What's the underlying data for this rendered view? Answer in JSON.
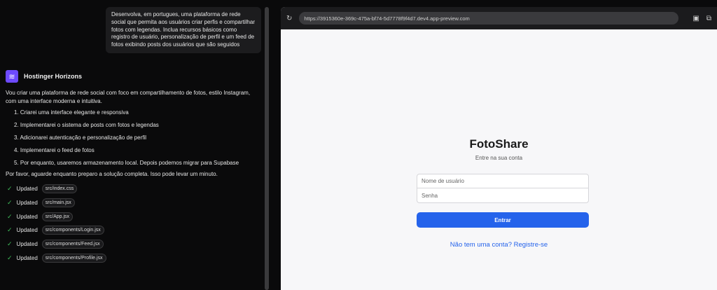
{
  "chat": {
    "user_prompt": "Desenvolva, em portugues, uma plataforma de rede social que permita aos usuários criar perfis e compartilhar fotos com legendas. Inclua recursos básicos como registro de usuário, personalização de perfil e um feed de fotos exibindo posts dos usuários que são seguidos",
    "agent_name": "Hostinger Horizons",
    "intro": "Vou criar uma plataforma de rede social com foco em compartilhamento de fotos, estilo Instagram, com uma interface moderna e intuitiva.",
    "steps": [
      "1. Criarei uma interface elegante e responsiva",
      "2. Implementarei o sistema de posts com fotos e legendas",
      "3. Adicionarei autenticação e personalização de perfil",
      "4. Implementarei o feed de fotos",
      "5. Por enquanto, usaremos armazenamento local. Depois podemos migrar para Supabase"
    ],
    "wait": "Por favor, aguarde enquanto preparo a solução completa. Isso pode levar um minuto.",
    "updates": [
      {
        "label": "Updated",
        "file": "src/index.css"
      },
      {
        "label": "Updated",
        "file": "src/main.jsx"
      },
      {
        "label": "Updated",
        "file": "src/App.jsx"
      },
      {
        "label": "Updated",
        "file": "src/components/Login.jsx"
      },
      {
        "label": "Updated",
        "file": "src/components/Feed.jsx"
      },
      {
        "label": "Updated",
        "file": "src/components/Profile.jsx"
      }
    ]
  },
  "browser": {
    "url": "https://3915360e-369c-475a-bf74-5d7778f9f4d7.dev4.app-preview.com"
  },
  "app": {
    "title": "FotoShare",
    "subtitle": "Entre na sua conta",
    "username_placeholder": "Nome de usuário",
    "password_placeholder": "Senha",
    "submit": "Entrar",
    "register_link": "Não tem uma conta? Registre-se"
  },
  "colors": {
    "accent": "#2563eb",
    "brand": "#6d4aff"
  }
}
